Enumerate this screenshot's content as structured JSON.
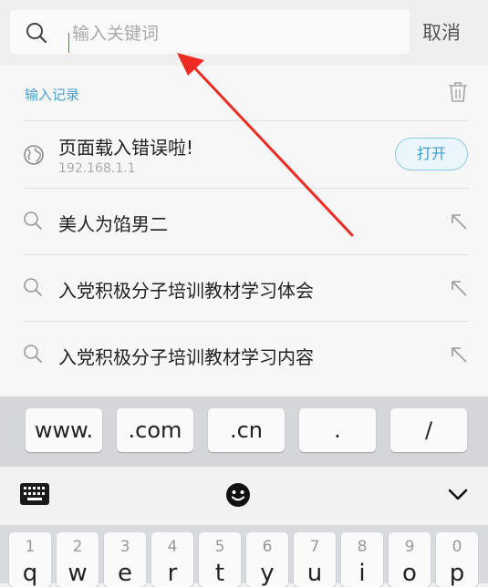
{
  "search": {
    "placeholder": "输入关键词",
    "value": "",
    "cancel_label": "取消"
  },
  "history": {
    "title": "输入记录",
    "items": [
      {
        "type": "page",
        "title": "页面载入错误啦!",
        "subtitle": "192.168.1.1",
        "action_label": "打开"
      },
      {
        "type": "query",
        "title": "美人为馅男二"
      },
      {
        "type": "query",
        "title": "入党积极分子培训教材学习体会"
      },
      {
        "type": "query",
        "title": "入党积极分子培训教材学习内容"
      }
    ]
  },
  "shortcuts": [
    "www.",
    ".com",
    ".cn",
    ".",
    "/"
  ],
  "keyboard": {
    "numbers": [
      "1",
      "2",
      "3",
      "4",
      "5",
      "6",
      "7",
      "8",
      "9",
      "0"
    ],
    "letters": [
      "q",
      "w",
      "e",
      "r",
      "t",
      "y",
      "u",
      "i",
      "o",
      "p"
    ]
  },
  "colors": {
    "accent": "#4a9fd0",
    "annotation": "#ee2b22"
  }
}
